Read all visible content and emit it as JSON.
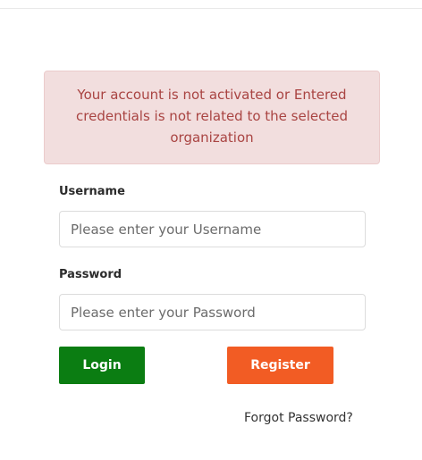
{
  "alert": {
    "message": "Your account is not activated or Entered credentials is not related to the selected organization"
  },
  "form": {
    "username_label": "Username",
    "username_placeholder": "Please enter your Username",
    "username_value": "",
    "password_label": "Password",
    "password_placeholder": "Please enter your Password",
    "password_value": "",
    "login_label": "Login",
    "register_label": "Register",
    "forgot_label": "Forgot Password?"
  },
  "colors": {
    "alert_bg": "#f2dede",
    "alert_text": "#a94442",
    "login_button": "#0b7d12",
    "register_button": "#f25c24"
  }
}
